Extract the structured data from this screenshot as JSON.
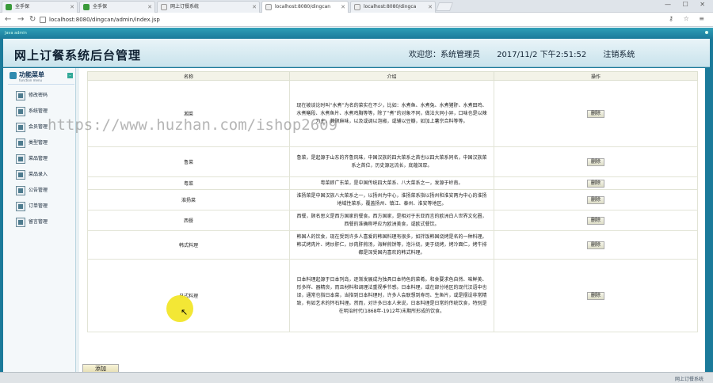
{
  "browser": {
    "tabs": [
      {
        "label": "全手保"
      },
      {
        "label": "全手保"
      },
      {
        "label": "网上订餐系统"
      },
      {
        "label": "localhost:8080/dingcan"
      },
      {
        "label": "localhost:8080/dingca"
      }
    ],
    "url": "localhost:8080/dingcan/admin/index.jsp",
    "window_controls": "— ☐ ✕",
    "toolbar_icons": "⚷ ☆ ≡"
  },
  "frame": {
    "caption": "Java admin"
  },
  "header": {
    "title": "网上订餐系统后台管理",
    "welcome": "欢迎您：系统管理员",
    "datetime": "2017/11/2 下午2:51:52",
    "logout": "注销系统"
  },
  "sidebar": {
    "title": "功能菜单",
    "subtitle": "function menu",
    "toggle": "-",
    "items": [
      {
        "label": "修改密码"
      },
      {
        "label": "系统管理"
      },
      {
        "label": "会员管理"
      },
      {
        "label": "类型管理"
      },
      {
        "label": "菜品管理"
      },
      {
        "label": "菜品录入"
      },
      {
        "label": "公告管理"
      },
      {
        "label": "订单管理"
      },
      {
        "label": "留言管理"
      }
    ]
  },
  "table": {
    "headers": {
      "name": "名称",
      "intro": "介绍",
      "op": "操作"
    },
    "delete_label": "删除",
    "rows": [
      {
        "name": "湘菜",
        "intro": "现在被谈论时叫“水煮”为名的菜实在不少，比如：水煮鱼、水煮兔、水煮猪肝、水煮田鸡、水煮鳝段、水煮鱼片、水煮鸡胸等等，除了“煮”的对象不同，做法大同小异，口味也是以辣为主，兼顾麻味，以及或调以泡椒，或辅以豆瓣，如加上薯宗合料等等。"
      },
      {
        "name": "鲁菜",
        "intro": "鲁菜，是起源于山东的齐鲁风味，中国汉族的四大菜系之首也以四大菜系同名，中国汉族菜系之首位，历史源远流长，底蕴深厚。"
      },
      {
        "name": "粤菜",
        "intro": "粤菜即广东菜，是中国传统四大菜系、八大菜系之一，发源于岭南。"
      },
      {
        "name": "淮扬菜",
        "intro": "淮扬菜是中国汉族八大菜系之一，以扬州为中心，淮扬菜系指以扬州和淮安两为中心的淮扬地域性菜系，覆盖扬州、镇江、泰州、淮安等地区。"
      },
      {
        "name": "西餐",
        "intro": "西餐，顾名思义是西方国家的餐食。西方国家，是相对于东亚而言的欧洲白人世界文化圈，西餐的准确称呼应为欧洲美食，或欧式餐饮。"
      },
      {
        "name": "韩式料理",
        "intro": "韩国人的饮食，现在受到许多人喜爱的韩国料理有很多，如拌饭韩国烧烤是名的一种料理。韩式烤肉片、烤炒肝仁，炒肉肝煎汤，海鲜煎饼等，泡汁烧，更于烧烤，烤冷面仁，烤牛排都是深受国内喜欢的韩式料理。"
      },
      {
        "name": "日式料理",
        "intro": "日本料理起源于日本列岛，逐渐发展成为独具日本特色的菜肴。和食要求色自然、味鲜美、形多样、器精良，而且材料和调理法重视季节感。日本料理，或在部分地区的现代汉语中也译，通常也指日本菜，当指到日本料理时，许多人会联想到寿司、生鱼片，或是摆设非常精致，有如艺术的怀石料理。然而，对许多日本人来说，日本料理是日常的传统饮食，特别是在明治时代(1868年-1912年)末期所形成的饮食。"
      }
    ]
  },
  "add_button": "添加",
  "status_bar": "网上订餐系统",
  "watermark": "https://www.huzhan.com/ishop2609"
}
